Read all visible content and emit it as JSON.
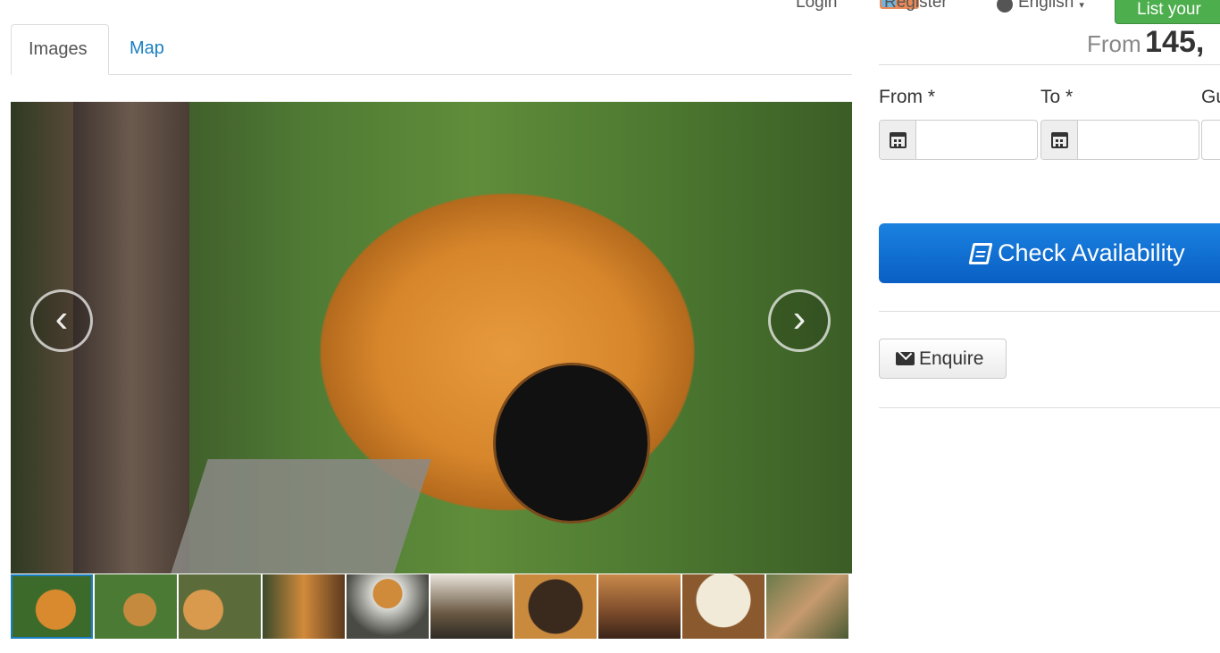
{
  "nav": {
    "login": "Login",
    "register": "Register",
    "language": "English",
    "list_button": "List your"
  },
  "tabs": [
    {
      "label": "Images",
      "active": true
    },
    {
      "label": "Map",
      "active": false
    }
  ],
  "gallery": {
    "prev": "‹",
    "next": "›",
    "thumbnail_count": 10,
    "active_thumbnail": 1
  },
  "booking": {
    "price_prefix": "From",
    "price_value": "145,",
    "from_label": "From *",
    "to_label": "To *",
    "guests_label": "Gu",
    "check_button": "Check Availability",
    "enquire_button": "Enquire"
  },
  "colors": {
    "link": "#1a7fc1",
    "primary": "#0a6fd6",
    "success": "#4cae4c"
  }
}
